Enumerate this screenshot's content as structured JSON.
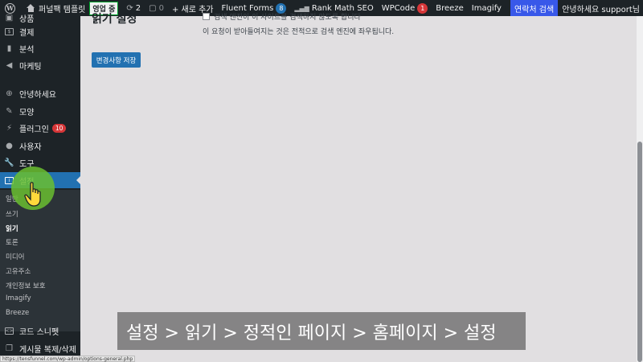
{
  "adminbar": {
    "site_name": "퍼널팩 템플릿",
    "live_badge": "영업 중",
    "updates_count": "2",
    "comments_count": "0",
    "new_label": "+ 새로 추가",
    "fluent_forms": "Fluent Forms",
    "fluent_forms_count": "8",
    "rank_math": "Rank Math SEO",
    "wpcode": "WPCode",
    "wpcode_count": "1",
    "breeze": "Breeze",
    "imagify": "Imagify",
    "contact_search": "연락처 검색",
    "greeting": "안녕하세요 support님"
  },
  "sidebar": {
    "items": [
      {
        "label": "결제",
        "icon": "dollar-icon"
      },
      {
        "label": "분석",
        "icon": "bar-chart-icon"
      },
      {
        "label": "마케팅",
        "icon": "megaphone-icon"
      },
      {
        "label": "안녕하세요",
        "icon": "plus-circle-icon"
      },
      {
        "label": "모양",
        "icon": "brush-icon"
      },
      {
        "label": "플러그인",
        "icon": "plugin-icon",
        "count": "10"
      },
      {
        "label": "사용자",
        "icon": "user-icon"
      },
      {
        "label": "도구",
        "icon": "wrench-icon"
      },
      {
        "label": "설정",
        "icon": "settings-icon"
      }
    ],
    "top_partial": "상품",
    "submenu": [
      "일반",
      "쓰기",
      "읽기",
      "토론",
      "미디어",
      "고유주소",
      "개인정보 보호",
      "Imagify",
      "Breeze"
    ],
    "bottom_items": [
      {
        "label": "코드 스니펫",
        "icon": "code-icon"
      },
      {
        "label": "게시물 복제/삭제",
        "icon": "copy-icon"
      }
    ]
  },
  "main": {
    "title_partial": "읽기 설정",
    "checkbox_partial": "검색 엔진이 이 사이트를 검색하지 않도록 합니다",
    "description": "이 요청이 받아들여지는 것은 전적으로 검색 엔진에 좌우됩니다.",
    "save_button": "변경사항 저장"
  },
  "caption": "설정 > 읽기 > 정적인 페이지 > 홈페이지 > 설정",
  "status_url": "https://tensfunnel.com/wp-admin/options-general.php",
  "colors": {
    "admin_bg": "#1d2327",
    "accent": "#2271b1",
    "contact_bg": "#3858e9",
    "badge_red": "#d63638",
    "cursor_green": "#6abe30"
  }
}
